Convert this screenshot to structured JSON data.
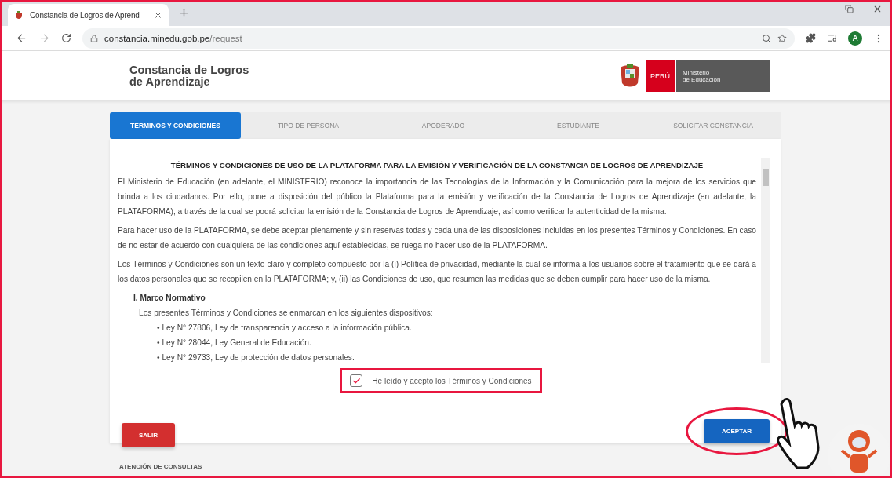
{
  "browser": {
    "tab_title": "Constancia de Logros de Aprend",
    "url_host": "constancia.minedu.gob.pe",
    "url_path": "/request",
    "avatar": "A"
  },
  "header": {
    "title_lines": [
      "Constancia de Logros",
      "de Aprendizaje"
    ],
    "logo": {
      "country": "PERÚ",
      "ministry_lines": [
        "Ministerio",
        "de Educación"
      ]
    }
  },
  "steps": [
    {
      "label": "TÉRMINOS Y CONDICIONES",
      "selected": true
    },
    {
      "label": "TIPO DE PERSONA",
      "selected": false
    },
    {
      "label": "APODERADO",
      "selected": false
    },
    {
      "label": "ESTUDIANTE",
      "selected": false
    },
    {
      "label": "SOLICITAR CONSTANCIA",
      "selected": false
    }
  ],
  "terms": {
    "title": "TÉRMINOS Y CONDICIONES DE USO DE LA PLATAFORMA PARA LA EMISIÓN Y VERIFICACIÓN DE LA CONSTANCIA DE LOGROS DE APRENDIZAJE",
    "paragraphs": [
      "El Ministerio de Educación (en adelante, el MINISTERIO) reconoce la importancia de las Tecnologías de la Información y la Comunicación para la mejora de los servicios que brinda a los ciudadanos. Por ello, pone a disposición del público la Plataforma para la emisión y verificación de la Constancia de Logros de Aprendizaje (en adelante, la PLATAFORMA), a través de la cual se podrá solicitar la emisión de la Constancia de Logros de Aprendizaje, así como verificar la autenticidad de la misma.",
      "Para hacer uso de la PLATAFORMA, se debe aceptar plenamente y sin reservas todas y cada una de las disposiciones incluidas en los presentes Términos y Condiciones. En caso de no estar de acuerdo con cualquiera de las condiciones aquí establecidas, se ruega no hacer uso de la PLATAFORMA.",
      "Los Términos y Condiciones son un texto claro y completo compuesto por la (i) Política de privacidad, mediante la cual se informa a los usuarios sobre el tratamiento que se dará a los datos personales que se recopilen en la PLATAFORMA; y, (ii) las Condiciones de uso, que resumen las medidas que se deben cumplir para hacer uso de la misma."
    ],
    "section": {
      "heading": "I. Marco Normativo",
      "intro": "Los presentes Términos y Condiciones se enmarcan en los siguientes dispositivos:",
      "items": [
        "• Ley N° 27806, Ley de transparencia y acceso a la información pública.",
        "• Ley N° 28044, Ley General de Educación.",
        "• Ley N° 29733, Ley de protección de datos personales."
      ]
    }
  },
  "consent": {
    "label": "He leído y acepto los Términos y Condiciones",
    "checked": true
  },
  "buttons": {
    "exit": "SALIR",
    "accept": "ACEPTAR"
  },
  "footer": {
    "heading": "ATENCIÓN DE CONSULTAS"
  }
}
